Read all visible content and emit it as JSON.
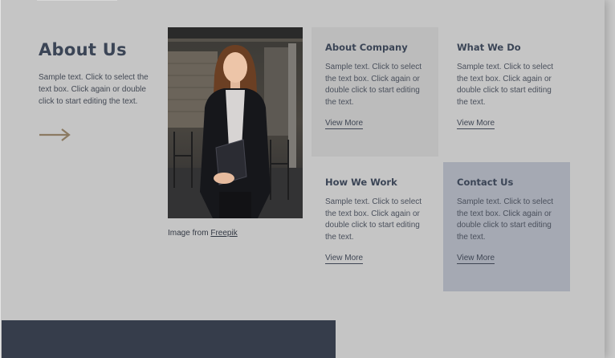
{
  "about": {
    "title": "About Us",
    "text": "Sample text. Click to select the text box. Click again or double click to start editing the text."
  },
  "image": {
    "caption_prefix": "Image from ",
    "caption_link": "Freepik"
  },
  "cards": [
    {
      "title": "About Company",
      "text": "Sample text. Click to select the text box. Click again or double click to start editing the text.",
      "link": "View More"
    },
    {
      "title": "What We Do",
      "text": "Sample text. Click to select the text box. Click again or double click to start editing the text.",
      "link": "View More"
    },
    {
      "title": "How We Work",
      "text": "Sample text. Click to select the text box. Click again or double click to start editing the text.",
      "link": "View More"
    },
    {
      "title": "Contact Us",
      "text": "Sample text. Click to select the text box. Click again or double click to start editing the text.",
      "link": "View More"
    }
  ],
  "colors": {
    "accent_arrow": "#8b7a62",
    "heading": "#3b4556",
    "footer_bar": "#363d4b",
    "card_gray": "#bcbcbc",
    "card_blue": "#a5a9b3"
  },
  "icons": {
    "arrow": "arrow-right-icon"
  }
}
